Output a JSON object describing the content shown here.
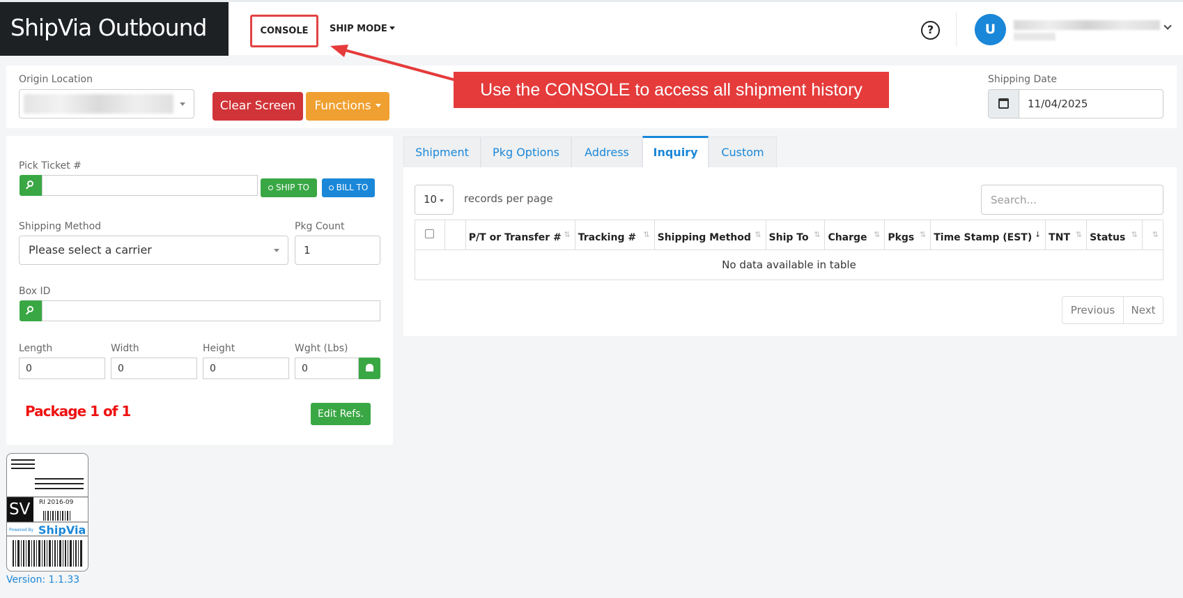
{
  "app": {
    "title": "ShipVia Outbound"
  },
  "nav": {
    "console_label": "CONSOLE",
    "shipmode_label": "SHIP MODE",
    "help_glyph": "?",
    "user_initial": "U"
  },
  "callout": {
    "text": "Use the CONSOLE to access all shipment history"
  },
  "header": {
    "origin_label": "Origin Location",
    "clear_label": "Clear Screen",
    "functions_label": "Functions",
    "shipping_date_label": "Shipping Date",
    "shipping_date_value": "11/04/2025"
  },
  "form": {
    "pick_ticket_label": "Pick Ticket #",
    "pick_ticket_value": "",
    "ship_to_label": "SHIP TO",
    "bill_to_label": "BILL TO",
    "shipping_method_label": "Shipping Method",
    "shipping_method_value": "Please select a carrier",
    "pkg_count_label": "Pkg Count",
    "pkg_count_value": "1",
    "box_id_label": "Box ID",
    "box_id_value": "",
    "length_label": "Length",
    "length_value": "0",
    "width_label": "Width",
    "width_value": "0",
    "height_label": "Height",
    "height_value": "0",
    "weight_label": "Wght (Lbs)",
    "weight_value": "0",
    "package_text": "Package 1 of 1",
    "edit_refs_label": "Edit Refs."
  },
  "logo": {
    "sv": "SV",
    "code": "RI 2016-09",
    "powered_by": "Powered By",
    "brand": "ShipVia"
  },
  "version": "Version: 1.1.33",
  "tabs": [
    "Shipment",
    "Pkg Options",
    "Address",
    "Inquiry",
    "Custom"
  ],
  "active_tab": "Inquiry",
  "table": {
    "page_length": "10",
    "records_per_page": "records per page",
    "search_placeholder": "Search...",
    "columns": [
      "P/T or Transfer #",
      "Tracking #",
      "Shipping Method",
      "Ship To",
      "Charge",
      "Pkgs",
      "Time Stamp (EST)",
      "TNT",
      "Status"
    ],
    "empty_message": "No data available in table",
    "prev_label": "Previous",
    "next_label": "Next"
  },
  "colors": {
    "brand_dark": "#1e2124",
    "primary": "#1a87d8",
    "success": "#3aa745",
    "danger": "#d13438",
    "warning": "#f0a030",
    "callout": "#e53b3b"
  }
}
